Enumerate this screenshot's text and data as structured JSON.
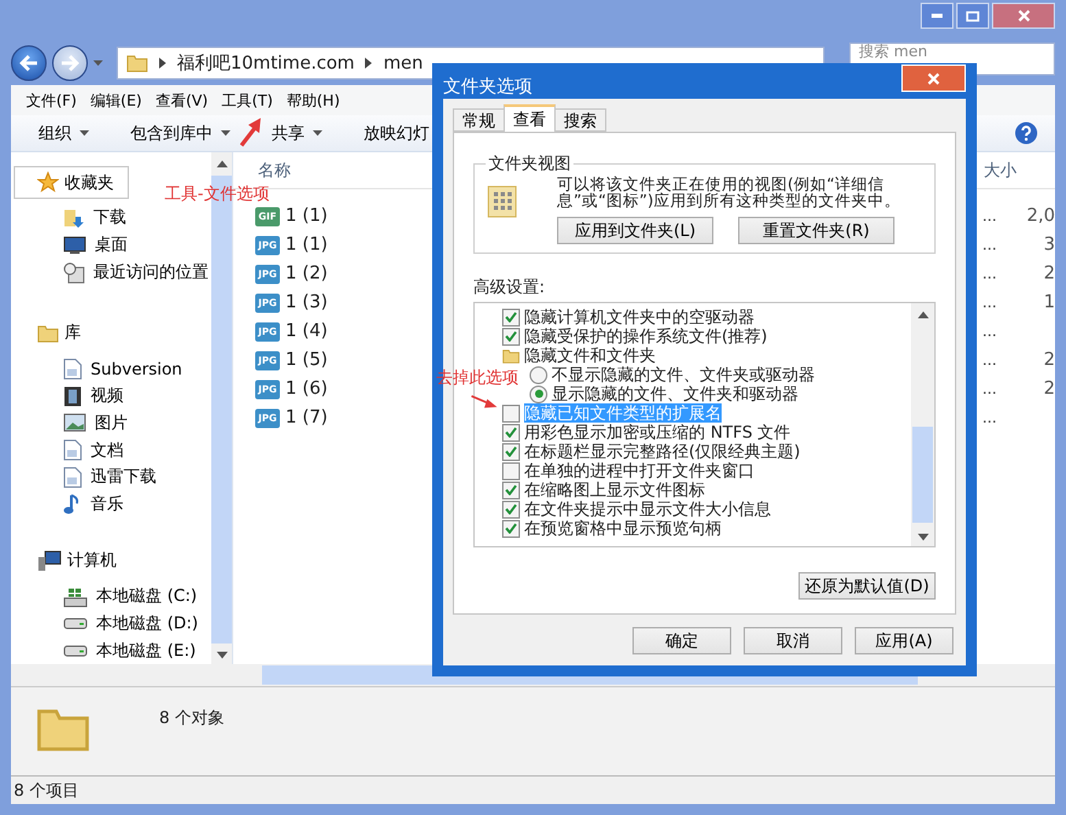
{
  "navigation": {
    "path": [
      "福利吧10mtime.com",
      "men"
    ],
    "search": {
      "placeholder": "搜索 men"
    }
  },
  "menu_bar": [
    "文件(F)",
    "编辑(E)",
    "查看(V)",
    "工具(T)",
    "帮助(H)"
  ],
  "toolbar": [
    {
      "label": "组织",
      "dropdown": true
    },
    {
      "label": "包含到库中",
      "dropdown": true
    },
    {
      "label": "共享",
      "dropdown": true
    },
    {
      "label": "放映幻灯",
      "dropdown": false
    }
  ],
  "sidebar": {
    "groups": [
      {
        "label": "收藏夹",
        "selected": true,
        "children": [
          {
            "label": "下载"
          },
          {
            "label": "桌面"
          },
          {
            "label": "最近访问的位置"
          }
        ]
      },
      {
        "label": "库",
        "selected": false,
        "children": [
          {
            "label": "Subversion"
          },
          {
            "label": "视频"
          },
          {
            "label": "图片"
          },
          {
            "label": "文档"
          },
          {
            "label": "迅雷下载"
          },
          {
            "label": "音乐"
          }
        ]
      },
      {
        "label": "计算机",
        "selected": false,
        "children": [
          {
            "label": "本地磁盘 (C:)"
          },
          {
            "label": "本地磁盘 (D:)"
          },
          {
            "label": "本地磁盘 (E:)"
          }
        ]
      }
    ]
  },
  "file_list": {
    "columns": [
      "名称",
      "大小"
    ],
    "rows": [
      {
        "name": "1 (1)",
        "type": "GIF",
        "column_2": "...",
        "size": "2,0"
      },
      {
        "name": "1 (1)",
        "type": "JPG",
        "column_2": "...",
        "size": "3"
      },
      {
        "name": "1 (2)",
        "type": "JPG",
        "column_2": "...",
        "size": "2"
      },
      {
        "name": "1 (3)",
        "type": "JPG",
        "column_2": "...",
        "size": "1"
      },
      {
        "name": "1 (4)",
        "type": "JPG",
        "column_2": "..."
      },
      {
        "name": "1 (5)",
        "type": "JPG",
        "column_2": "...",
        "size": "2"
      },
      {
        "name": "1 (6)",
        "type": "JPG",
        "column_2": "...",
        "size": "2"
      },
      {
        "name": "1 (7)",
        "type": "JPG",
        "column_2": "..."
      }
    ]
  },
  "details_pane": {
    "text": "8 个对象"
  },
  "status_bar": "8 个项目",
  "dialog": {
    "title": "文件夹选项",
    "tabs": [
      {
        "label": "常规",
        "selected": false
      },
      {
        "label": "查看",
        "selected": true
      },
      {
        "label": "搜索",
        "selected": false
      }
    ],
    "folder_views": {
      "title": "文件夹视图",
      "description": "可以将该文件夹正在使用的视图(例如“详细信息”或“图标”)应用到所有这种类型的文件夹中。",
      "buttons": [
        "应用到文件夹(L)",
        "重置文件夹(R)"
      ]
    },
    "advanced_label": "高级设置:",
    "advanced_items": [
      {
        "kind": "checkbox",
        "label": "隐藏计算机文件夹中的空驱动器",
        "checked": true,
        "selected": false
      },
      {
        "kind": "checkbox",
        "label": "隐藏受保护的操作系统文件(推荐)",
        "checked": true,
        "selected": false
      },
      {
        "kind": "folder",
        "label": "隐藏文件和文件夹",
        "selected": false,
        "children": [
          {
            "kind": "radio",
            "label": "不显示隐藏的文件、文件夹或驱动器",
            "checked": false,
            "selected": false
          },
          {
            "kind": "radio",
            "label": "显示隐藏的文件、文件夹和驱动器",
            "checked": true,
            "selected": false
          }
        ]
      },
      {
        "kind": "checkbox",
        "label": "隐藏已知文件类型的扩展名",
        "checked": false,
        "selected": true
      },
      {
        "kind": "checkbox",
        "label": "用彩色显示加密或压缩的 NTFS 文件",
        "checked": true,
        "selected": false
      },
      {
        "kind": "checkbox",
        "label": "在标题栏显示完整路径(仅限经典主题)",
        "checked": true,
        "selected": false
      },
      {
        "kind": "checkbox",
        "label": "在单独的进程中打开文件夹窗口",
        "checked": false,
        "selected": false
      },
      {
        "kind": "checkbox",
        "label": "在缩略图上显示文件图标",
        "checked": true,
        "selected": false
      },
      {
        "kind": "checkbox",
        "label": "在文件夹提示中显示文件大小信息",
        "checked": true,
        "selected": false
      },
      {
        "kind": "checkbox",
        "label": "在预览窗格中显示预览句柄",
        "checked": true,
        "selected": false
      }
    ],
    "restore_button": "还原为默认值(D)",
    "buttons": [
      "确定",
      "取消",
      "应用(A)"
    ]
  },
  "annotations": [
    {
      "kind": "menu-hint",
      "text": "工具-文件选项"
    },
    {
      "kind": "option-hint",
      "text": "去掉此选项"
    }
  ]
}
